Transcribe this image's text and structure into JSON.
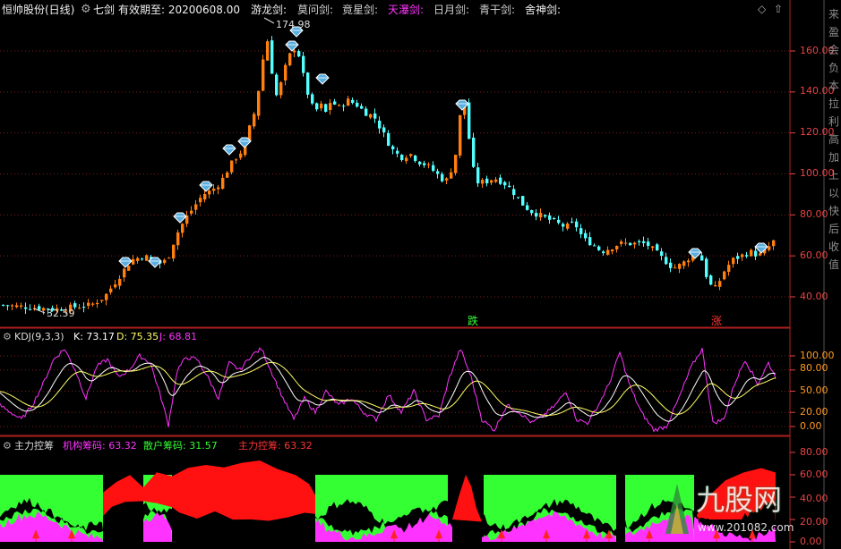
{
  "header": {
    "title": "恒帅股份(日线)",
    "indicator": "七剑",
    "expiry": "有效期至: 20200608.00",
    "swords": [
      {
        "label": "游龙剑:",
        "color": "#f0f0f0"
      },
      {
        "label": "莫问剑:",
        "color": "#cfcfcf"
      },
      {
        "label": "竟星剑:",
        "color": "#cfcfcf"
      },
      {
        "label": "天瀑剑:",
        "color": "#ff33ff"
      },
      {
        "label": "日月剑:",
        "color": "#cfcfcf"
      },
      {
        "label": "青干剑:",
        "color": "#cfcfcf"
      },
      {
        "label": "舍神剑:",
        "color": "#f0f0f0"
      }
    ]
  },
  "price_panel": {
    "axis_labels": [
      "160.00",
      "140.00",
      "120.00",
      "100.00",
      "80.00",
      "60.00",
      "40.00"
    ],
    "axis_values": [
      160,
      140,
      120,
      100,
      80,
      60,
      40
    ],
    "high_label": "174.98",
    "low_label": "32.59",
    "marker_die": "跌",
    "marker_zhang": "涨",
    "colors": {
      "up": "#ff7f0f",
      "down": "#54ffff",
      "marker": "#59aee0",
      "axis": "#e84545",
      "grid": "#7a1f1f"
    }
  },
  "kdj_panel": {
    "name": "KDJ(9,3,3)",
    "k_label": "K: 73.17",
    "d_label": "D: 75.35",
    "j_label": "J: 68.81",
    "axis_labels": [
      "100.00",
      "80.00",
      "50.00",
      "20.00",
      "0.00"
    ],
    "axis_values": [
      100,
      80,
      50,
      20,
      0
    ],
    "colors": {
      "k": "#ffffff",
      "d": "#ffff66",
      "j": "#ff33ff",
      "axis": "#ff9922"
    }
  },
  "chip_panel": {
    "name": "主力控筹",
    "jigou_label": "机构筹码: 63.32",
    "sanhu_label": "散户筹码: 31.57",
    "zhuli_label": "主力控筹: 63.32",
    "axis_labels": [
      "80.00",
      "60.00",
      "40.00",
      "20.00",
      "0.00"
    ],
    "axis_values": [
      80,
      60,
      40,
      20,
      0
    ],
    "colors": {
      "jigou": "#ff33ff",
      "sanhu": "#33ff33",
      "zhuli": "#ff2222",
      "bg_green": "#33ff33",
      "bg_red": "#ff1111",
      "magenta": "#ff33ff",
      "axis": "#e84545"
    }
  },
  "side_strip": {
    "glyphs": [
      "来",
      "盈",
      "会",
      "负",
      "本",
      "拉",
      "利",
      "高",
      "加",
      "上",
      "以",
      "快",
      "后",
      "收",
      "值"
    ]
  },
  "watermark": {
    "text": "九股网",
    "url": "www.201082.com"
  }
}
